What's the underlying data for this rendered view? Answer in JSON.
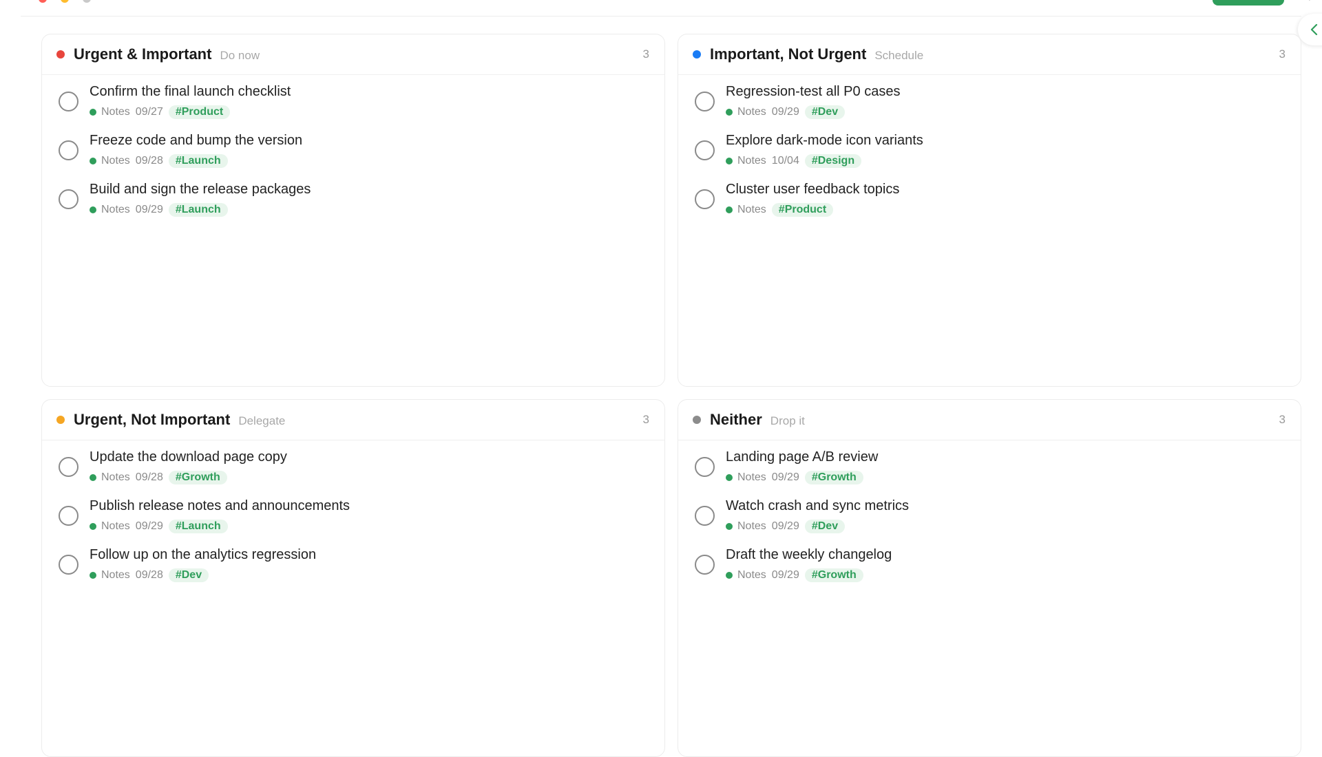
{
  "colors": {
    "accent": "#2f9e5b",
    "red": "#e8453c",
    "blue": "#1a7cf5",
    "orange": "#f5a623",
    "gray": "#8c8c8c"
  },
  "icons": {
    "collapse": "chevron-left-icon",
    "more": "more-icon"
  },
  "quadrants": [
    {
      "title": "Urgent & Important",
      "hint": "Do now",
      "count": "3",
      "tasks": [
        {
          "title": "Confirm the final launch checklist",
          "notebook": "Notes",
          "date": "09/27",
          "tag": "#Product"
        },
        {
          "title": "Freeze code and bump the version",
          "notebook": "Notes",
          "date": "09/28",
          "tag": "#Launch"
        },
        {
          "title": "Build and sign the release packages",
          "notebook": "Notes",
          "date": "09/29",
          "tag": "#Launch"
        }
      ]
    },
    {
      "title": "Important, Not Urgent",
      "hint": "Schedule",
      "count": "3",
      "tasks": [
        {
          "title": "Regression-test all P0 cases",
          "notebook": "Notes",
          "date": "09/29",
          "tag": "#Dev"
        },
        {
          "title": "Explore dark-mode icon variants",
          "notebook": "Notes",
          "date": "10/04",
          "tag": "#Design"
        },
        {
          "title": "Cluster user feedback topics",
          "notebook": "Notes",
          "date": "",
          "tag": "#Product"
        }
      ]
    },
    {
      "title": "Urgent, Not Important",
      "hint": "Delegate",
      "count": "3",
      "tasks": [
        {
          "title": "Update the download page copy",
          "notebook": "Notes",
          "date": "09/28",
          "tag": "#Growth"
        },
        {
          "title": "Publish release notes and announcements",
          "notebook": "Notes",
          "date": "09/29",
          "tag": "#Launch"
        },
        {
          "title": "Follow up on the analytics regression",
          "notebook": "Notes",
          "date": "09/28",
          "tag": "#Dev"
        }
      ]
    },
    {
      "title": "Neither",
      "hint": "Drop it",
      "count": "3",
      "tasks": [
        {
          "title": "Landing page A/B review",
          "notebook": "Notes",
          "date": "09/29",
          "tag": "#Growth"
        },
        {
          "title": "Watch crash and sync metrics",
          "notebook": "Notes",
          "date": "09/29",
          "tag": "#Dev"
        },
        {
          "title": "Draft the weekly changelog",
          "notebook": "Notes",
          "date": "09/29",
          "tag": "#Growth"
        }
      ]
    }
  ]
}
